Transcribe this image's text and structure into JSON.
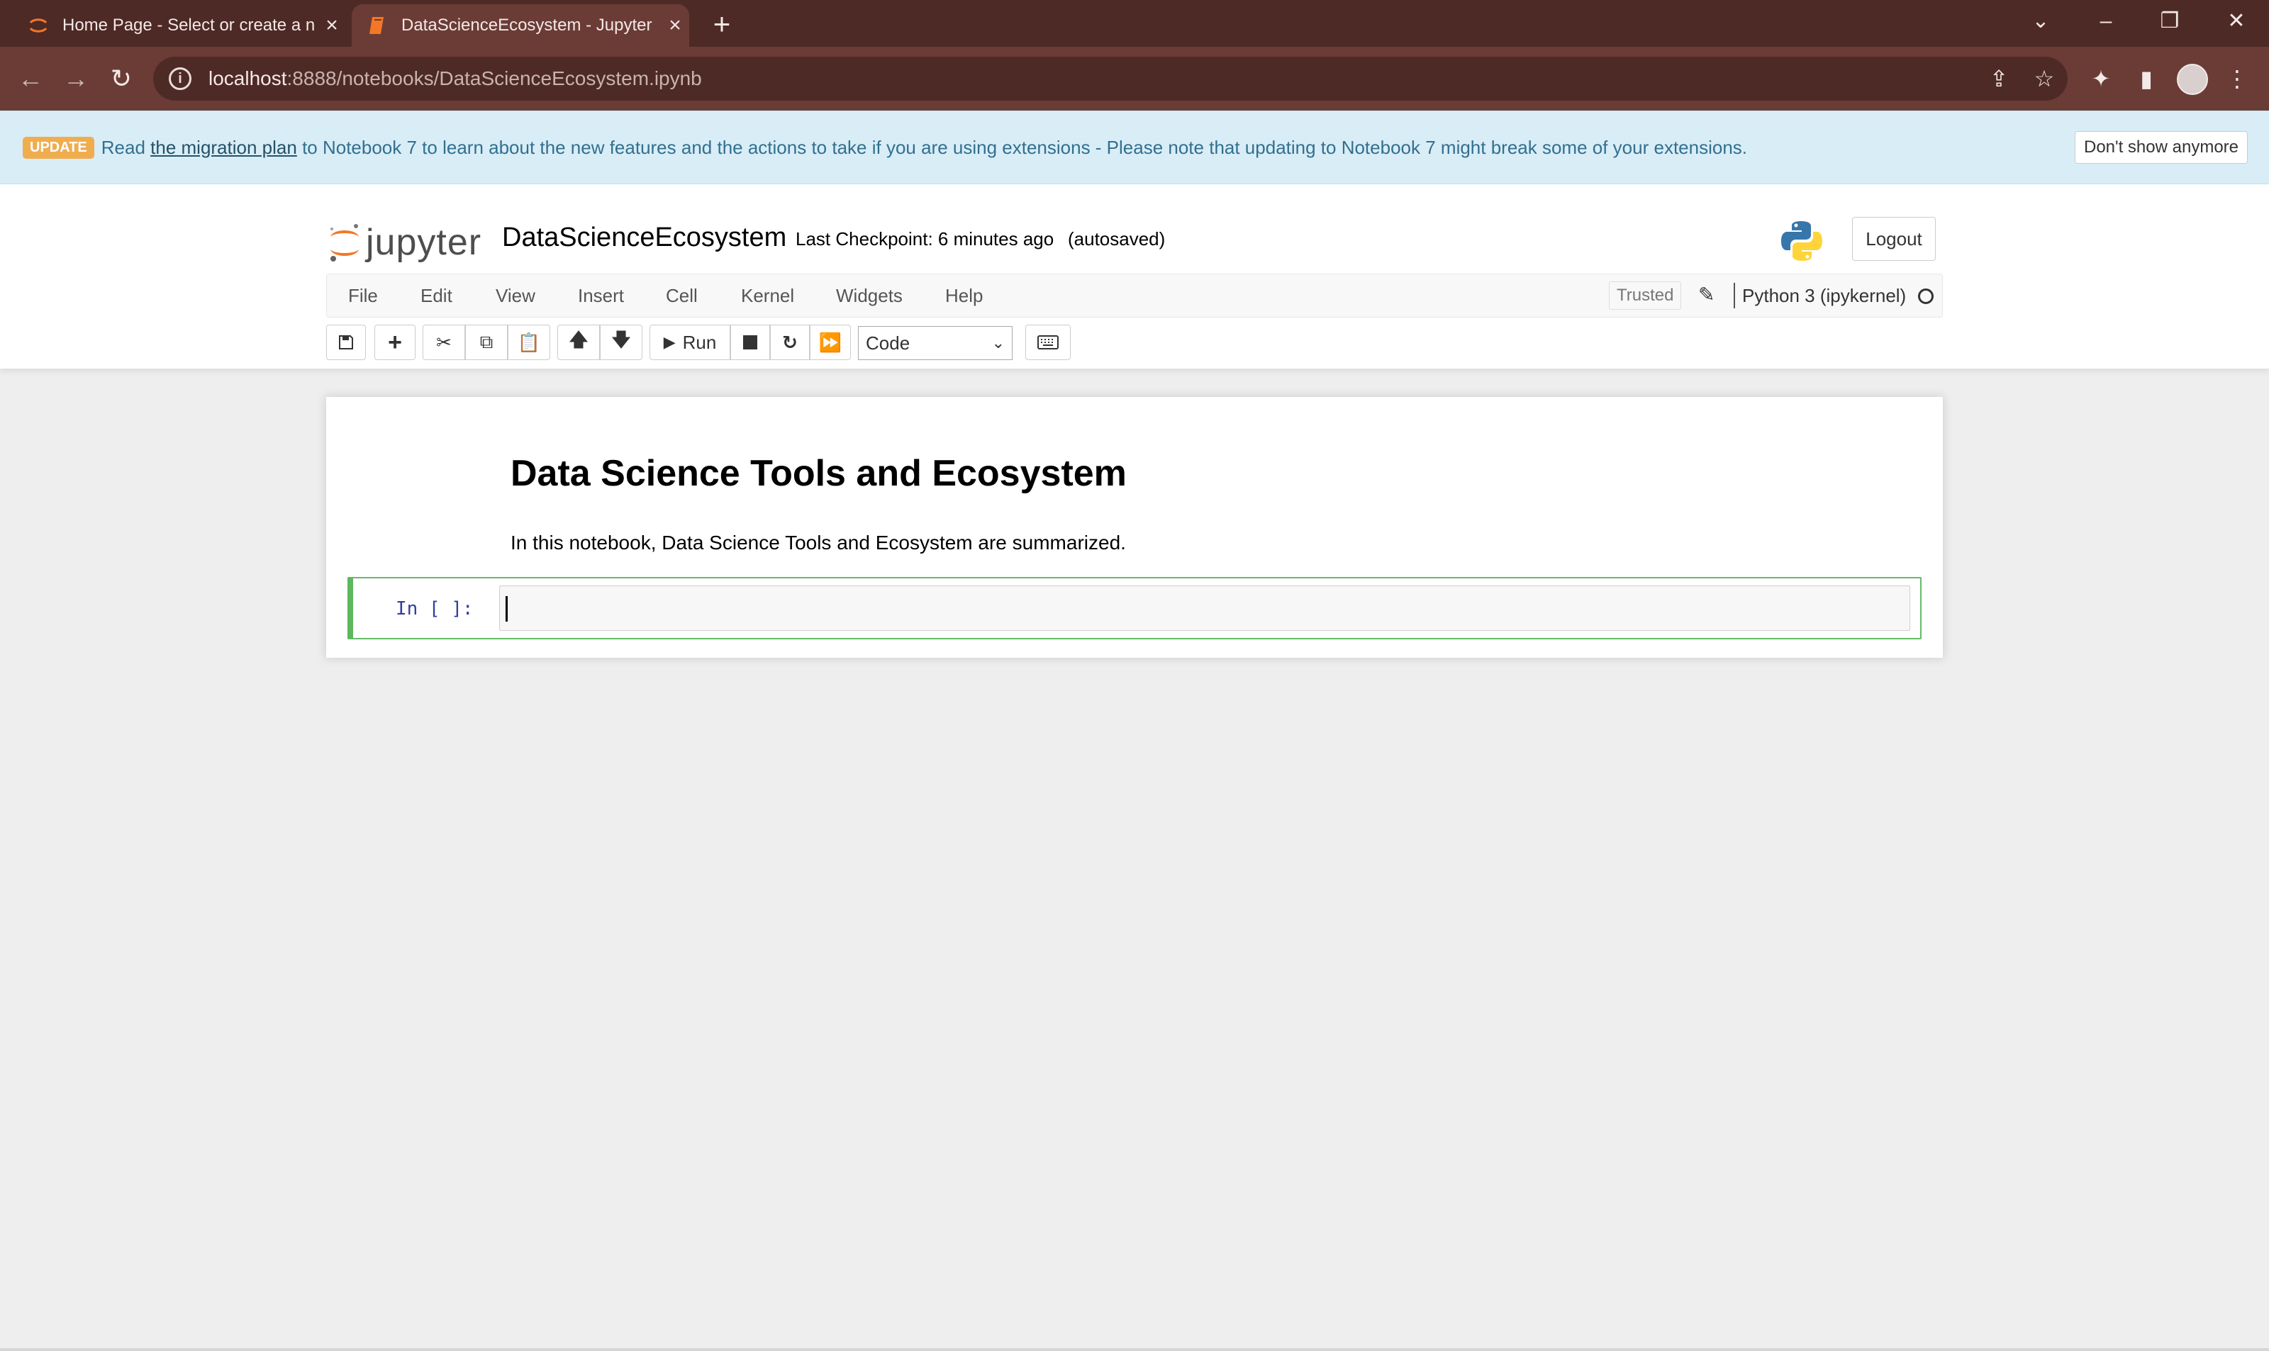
{
  "browser": {
    "tabs": [
      {
        "title": "Home Page - Select or create a n",
        "active": false,
        "icon": "jupyter-tab-icon"
      },
      {
        "title": "DataScienceEcosystem - Jupyter",
        "active": true,
        "icon": "notebook-tab-icon"
      }
    ],
    "url_host": "localhost",
    "url_path": ":8888/notebooks/DataScienceEcosystem.ipynb",
    "colors": {
      "tabstrip": "#4e2a26",
      "toolbar": "#6b3c36"
    }
  },
  "banner": {
    "badge": "UPDATE",
    "text_before": "Read",
    "link": "the migration plan",
    "text_after": "to Notebook 7 to learn about the new features and the actions to take if you are using extensions - Please note that updating to Notebook 7 might break some of your extensions.",
    "dismiss_label": "Don't show anymore"
  },
  "header": {
    "logo_text": "jupyter",
    "notebook_title": "DataScienceEcosystem",
    "checkpoint": "Last Checkpoint: 6 minutes ago",
    "autosave": "(autosaved)",
    "logout_label": "Logout"
  },
  "menubar": {
    "items": [
      "File",
      "Edit",
      "View",
      "Insert",
      "Cell",
      "Kernel",
      "Widgets",
      "Help"
    ],
    "trusted_label": "Trusted",
    "kernel_name": "Python 3 (ipykernel)"
  },
  "toolbar": {
    "run_label": "Run",
    "cell_type": "Code"
  },
  "notebook": {
    "heading": "Data Science Tools and Ecosystem",
    "paragraph": "In this notebook, Data Science Tools and Ecosystem are summarized.",
    "code_prompt": "In [ ]:",
    "code_value": ""
  }
}
